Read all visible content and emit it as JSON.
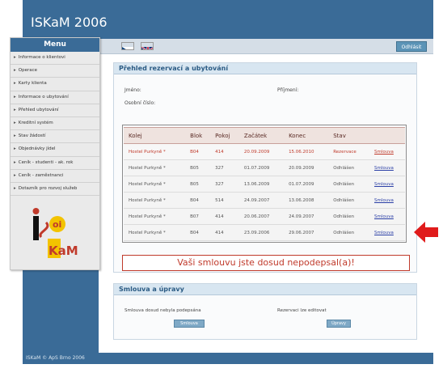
{
  "app": {
    "title": "ISKaM 2006"
  },
  "header": {
    "logout_label": "Odhlásit"
  },
  "sidebar": {
    "menu_title": "Menu",
    "items": [
      {
        "label": "Informace o klientovi"
      },
      {
        "label": "Operace"
      },
      {
        "label": "Karty klienta"
      },
      {
        "label": "Informace o ubytování"
      },
      {
        "label": "Přehled ubytování"
      },
      {
        "label": "Kreditní systém"
      },
      {
        "label": "Stav žádostí"
      },
      {
        "label": "Objednávky jídel"
      },
      {
        "label": "Ceník - studenti - ak. rok"
      },
      {
        "label": "Ceník - zaměstnanci"
      },
      {
        "label": "Dotazník pro rozvoj služeb"
      }
    ]
  },
  "overview": {
    "title": "Přehled rezervací a ubytování",
    "name_label": "Jméno:",
    "surname_label": "Příjmení:",
    "id_label": "Osobní číslo:",
    "columns": [
      "Kolej",
      "Blok",
      "Pokoj",
      "Začátek",
      "Konec",
      "Stav",
      ""
    ],
    "rows": [
      {
        "kolej": "Hostel Purkyně *",
        "blok": "B04",
        "pokoj": "414",
        "zacatek": "20.09.2009",
        "konec": "15.06.2010",
        "stav": "Rezervace",
        "link": "Smlouva",
        "highlight": true
      },
      {
        "kolej": "Hostel Purkyně *",
        "blok": "B05",
        "pokoj": "327",
        "zacatek": "01.07.2009",
        "konec": "20.09.2009",
        "stav": "Odhlášen",
        "link": "Smlouva",
        "highlight": false
      },
      {
        "kolej": "Hostel Purkyně *",
        "blok": "B05",
        "pokoj": "327",
        "zacatek": "13.06.2009",
        "konec": "01.07.2009",
        "stav": "Odhlášen",
        "link": "Smlouva",
        "highlight": false
      },
      {
        "kolej": "Hostel Purkyně *",
        "blok": "B04",
        "pokoj": "514",
        "zacatek": "24.09.2007",
        "konec": "13.06.2008",
        "stav": "Odhlášen",
        "link": "Smlouva",
        "highlight": false
      },
      {
        "kolej": "Hostel Purkyně *",
        "blok": "B07",
        "pokoj": "414",
        "zacatek": "20.06.2007",
        "konec": "24.09.2007",
        "stav": "Odhlášen",
        "link": "Smlouva",
        "highlight": false
      },
      {
        "kolej": "Hostel Purkyně *",
        "blok": "B04",
        "pokoj": "414",
        "zacatek": "23.09.2006",
        "konec": "29.06.2007",
        "stav": "Odhlášen",
        "link": "Smlouva",
        "highlight": false
      }
    ],
    "warning": "Vaši smlouvu jste dosud nepodepsal(a)!"
  },
  "contracts": {
    "title": "Smlouva a úpravy",
    "left_text": "Smlouva dosud nebyla podepsána",
    "left_button": "Smlouva",
    "right_text": "Rezervaci lze editovat",
    "right_button": "Úpravy"
  },
  "footer": {
    "text": "ISKaM © ApS Brno 2006"
  },
  "colors": {
    "brand_blue": "#3a6b97",
    "warning_red": "#c03a2b",
    "link_blue": "#2b3fa6"
  }
}
